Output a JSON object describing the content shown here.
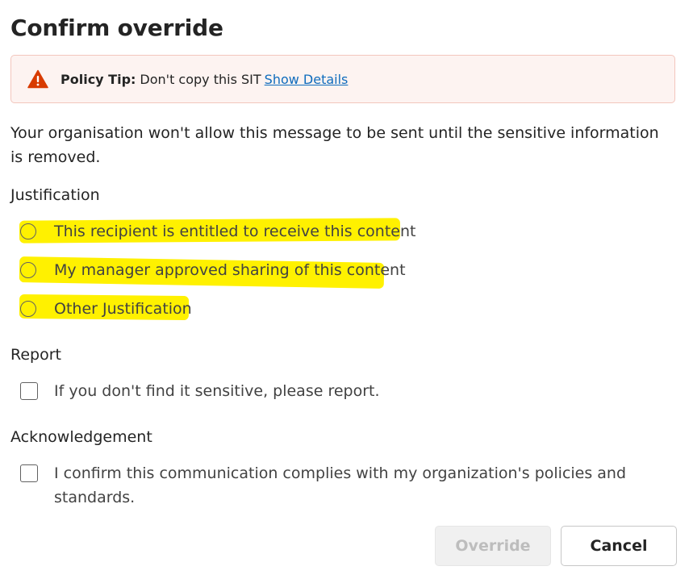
{
  "dialog": {
    "title": "Confirm override"
  },
  "policy_tip": {
    "icon": "warning-triangle-icon",
    "icon_color": "#d83b01",
    "bold_label": "Policy Tip:",
    "text": "Don't copy this SIT",
    "link_text": "Show Details"
  },
  "message": "Your organisation won't allow this message to be sent until the sensitive information is removed.",
  "justification": {
    "label": "Justification",
    "options": [
      {
        "label": "This recipient is entitled to receive this content",
        "selected": false
      },
      {
        "label": "My manager approved sharing of this content",
        "selected": false
      },
      {
        "label": "Other Justification",
        "selected": false
      }
    ],
    "highlight_color": "#fff100"
  },
  "report": {
    "label": "Report",
    "checkbox_label": "If you don't find it sensitive, please report.",
    "checked": false
  },
  "acknowledgement": {
    "label": "Acknowledgement",
    "checkbox_label": "I confirm this communication complies with my organization's policies and standards.",
    "checked": false
  },
  "buttons": {
    "override_label": "Override",
    "override_disabled": true,
    "cancel_label": "Cancel"
  }
}
